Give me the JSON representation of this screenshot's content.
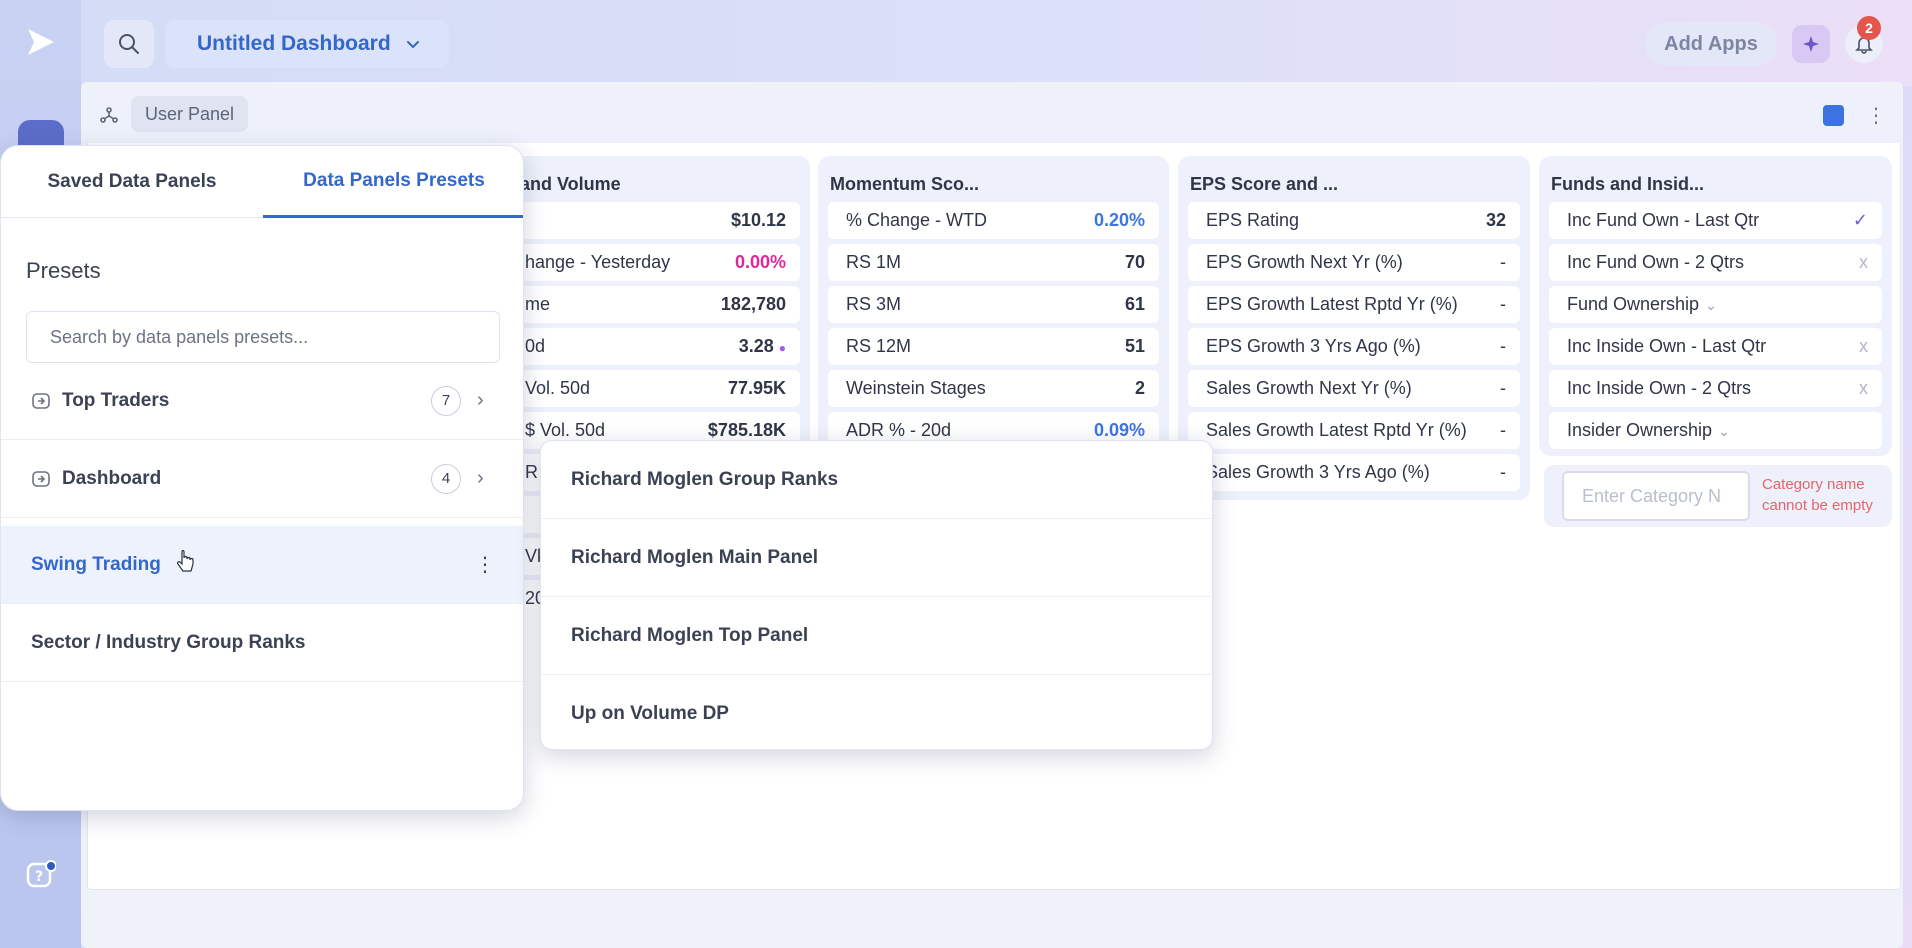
{
  "header": {
    "dashboard_title": "Untitled Dashboard",
    "add_apps": "Add Apps",
    "notification_count": "2"
  },
  "panel": {
    "user_panel_chip": "User Panel"
  },
  "cards": {
    "price_volume": {
      "title": "and Volume",
      "rows": [
        {
          "label": "",
          "value": "$10.12"
        },
        {
          "label": "hange - Yesterday",
          "value": "0.00%"
        },
        {
          "label": "me",
          "value": "182,780"
        },
        {
          "label": "0d",
          "value": "3.28"
        },
        {
          "label": "Vol. 50d",
          "value": "77.95K"
        },
        {
          "label": "$ Vol. 50d",
          "value": "$785.18K"
        }
      ],
      "partial_labels": [
        "R",
        "Vk",
        "20"
      ]
    },
    "momentum": {
      "title": "Momentum Sco...",
      "rows": [
        {
          "label": "% Change - WTD",
          "value": "0.20%"
        },
        {
          "label": "RS 1M",
          "value": "70"
        },
        {
          "label": "RS 3M",
          "value": "61"
        },
        {
          "label": "RS 12M",
          "value": "51"
        },
        {
          "label": "Weinstein Stages",
          "value": "2"
        },
        {
          "label": "ADR % - 20d",
          "value": "0.09%"
        }
      ]
    },
    "eps": {
      "title": "EPS Score and ...",
      "rows": [
        {
          "label": "EPS Rating",
          "value": "32"
        },
        {
          "label": "EPS Growth Next Yr (%)",
          "value": "-"
        },
        {
          "label": "EPS Growth Latest Rptd Yr (%)",
          "value": "-"
        },
        {
          "label": "EPS Growth 3 Yrs Ago (%)",
          "value": "-"
        },
        {
          "label": "Sales Growth Next Yr (%)",
          "value": "-"
        },
        {
          "label": "Sales Growth Latest Rptd Yr (%)",
          "value": "-"
        },
        {
          "label": "Sales Growth 3 Yrs Ago (%)",
          "value": "-"
        }
      ]
    },
    "funds": {
      "title": "Funds and Insid...",
      "rows": [
        {
          "label": "Inc Fund Own - Last Qtr",
          "value": "✓"
        },
        {
          "label": "Inc Fund Own - 2 Qtrs",
          "value": "x"
        },
        {
          "label": "Fund Ownership",
          "value": ""
        },
        {
          "label": "Inc Inside Own - Last Qtr",
          "value": "x"
        },
        {
          "label": "Inc Inside Own - 2 Qtrs",
          "value": "x"
        },
        {
          "label": "Insider Ownership",
          "value": ""
        }
      ],
      "category_placeholder": "Enter Category N",
      "category_error_line1": "Category name",
      "category_error_line2": "cannot be empty"
    }
  },
  "popup": {
    "tab_saved": "Saved Data Panels",
    "tab_presets": "Data Panels Presets",
    "presets_heading": "Presets",
    "search_placeholder": "Search by data panels presets...",
    "items": [
      {
        "label": "Top Traders",
        "count": "7"
      },
      {
        "label": "Dashboard",
        "count": "4"
      },
      {
        "label": "Swing Trading"
      },
      {
        "label": "Sector / Industry Group Ranks"
      }
    ]
  },
  "dropdown": {
    "items": [
      "Richard Moglen Group Ranks",
      "Richard Moglen Main Panel",
      "Richard Moglen Top Panel",
      "Up on Volume DP"
    ]
  },
  "colors": {
    "accent": "#3467c9",
    "pink": "#e0289a",
    "blue_value": "#3d76e0",
    "error": "#e5646a"
  }
}
